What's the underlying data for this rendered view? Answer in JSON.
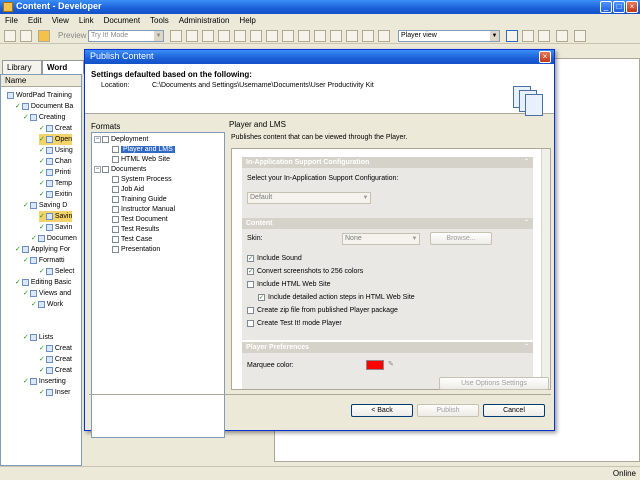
{
  "window": {
    "title": "Content - Developer",
    "min": "_",
    "max": "□",
    "close": "×"
  },
  "menu": [
    "File",
    "Edit",
    "View",
    "Link",
    "Document",
    "Tools",
    "Administration",
    "Help"
  ],
  "toolbar": {
    "preview": "Preview",
    "mode": "Try It! Mode",
    "view": "Player view"
  },
  "tabs": {
    "library": "Library",
    "word": "Word"
  },
  "leftpane": {
    "header": "Name",
    "nodes": [
      "WordPad Training",
      "Document Ba",
      "Creating",
      "Creat",
      "Open",
      "Using",
      "Chan",
      "Printi",
      "Temp",
      "Exitin",
      "Saving D",
      "Savin",
      "Savin",
      "Documen",
      "Applying For",
      "Formatti",
      "Select",
      "Editing Basic",
      "Views and",
      "Work",
      "Lists",
      "Creat",
      "Creat",
      "Creat",
      "Inserting",
      "Inser"
    ]
  },
  "status": {
    "online": "Online"
  },
  "dialog": {
    "title": "Publish Content",
    "close": "×",
    "heading": "Settings defaulted based on the following:",
    "location_label": "Location:",
    "location_value": "C:\\Documents and Settings\\Username\\Documents\\User Productivity Kit",
    "formats_label": "Formats",
    "formats": {
      "deployment": "Deployment",
      "player_lms": "Player and LMS",
      "html_web_site": "HTML Web Site",
      "documents": "Documents",
      "doc_items": [
        "System Process",
        "Job Aid",
        "Training Guide",
        "Instructor Manual",
        "Test Document",
        "Test Results",
        "Test Case",
        "Presentation"
      ]
    },
    "props_title": "Player and LMS",
    "props_desc": "Publishes content that can be viewed through the Player.",
    "sec1": {
      "title": "In-Application Support Configuration",
      "label": "Select your In-Application Support Configuration:",
      "value": "Default"
    },
    "sec2": {
      "title": "Content",
      "skin_label": "Skin:",
      "skin_value": "None",
      "browse": "Browse...",
      "options": [
        {
          "label": "Include Sound",
          "checked": true
        },
        {
          "label": "Convert screenshots to 256 colors",
          "checked": true
        },
        {
          "label": "Include HTML Web Site",
          "checked": false
        },
        {
          "label": "Include detailed action steps in HTML Web Site",
          "checked": true
        },
        {
          "label": "Create zip file from published Player package",
          "checked": false
        },
        {
          "label": "Create Test It! mode Player",
          "checked": false
        }
      ]
    },
    "sec3": {
      "title": "Player Preferences",
      "marquee": "Marquee color:",
      "marquee_color": "#ff0000"
    },
    "use_options": "Use Options Settings",
    "back": "< Back",
    "publish": "Publish",
    "cancel": "Cancel"
  },
  "colors": {
    "titlebar": "#1a5fd6",
    "selection": "#316ac5",
    "tree_highlight": "#f3d36a"
  }
}
